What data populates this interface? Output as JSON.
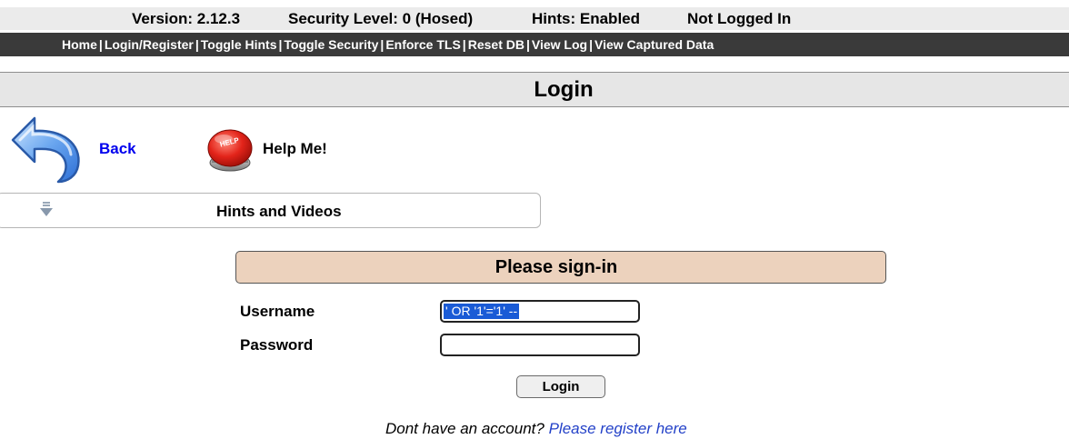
{
  "status_bar": {
    "version": "Version: 2.12.3",
    "security_level": "Security Level: 0 (Hosed)",
    "hints": "Hints: Enabled",
    "login_status": "Not Logged In"
  },
  "nav": {
    "items": [
      "Home",
      "Login/Register",
      "Toggle Hints",
      "Toggle Security",
      "Enforce TLS",
      "Reset DB",
      "View Log",
      "View Captured Data"
    ],
    "separator": "|"
  },
  "page_title": "Login",
  "back_label": "Back",
  "help_label": "Help Me!",
  "help_button_text": "HELP",
  "hints_label": "Hints and Videos",
  "signin": {
    "header": "Please sign-in",
    "username_label": "Username",
    "username_value": "' OR '1'='1' --",
    "password_label": "Password",
    "password_value": "",
    "login_button": "Login"
  },
  "register": {
    "prompt": "Dont have an account?",
    "link": "Please register here"
  },
  "colors": {
    "nav_bg": "#3a3a3a",
    "status_bg": "#ebebeb",
    "signin_header_bg": "#ecd2bd",
    "link": "#0000ee",
    "selection": "#1a5bd6"
  },
  "icons": {
    "back": "back-arrow-icon",
    "help": "help-button-icon",
    "hints": "expand-down-arrow-icon"
  }
}
